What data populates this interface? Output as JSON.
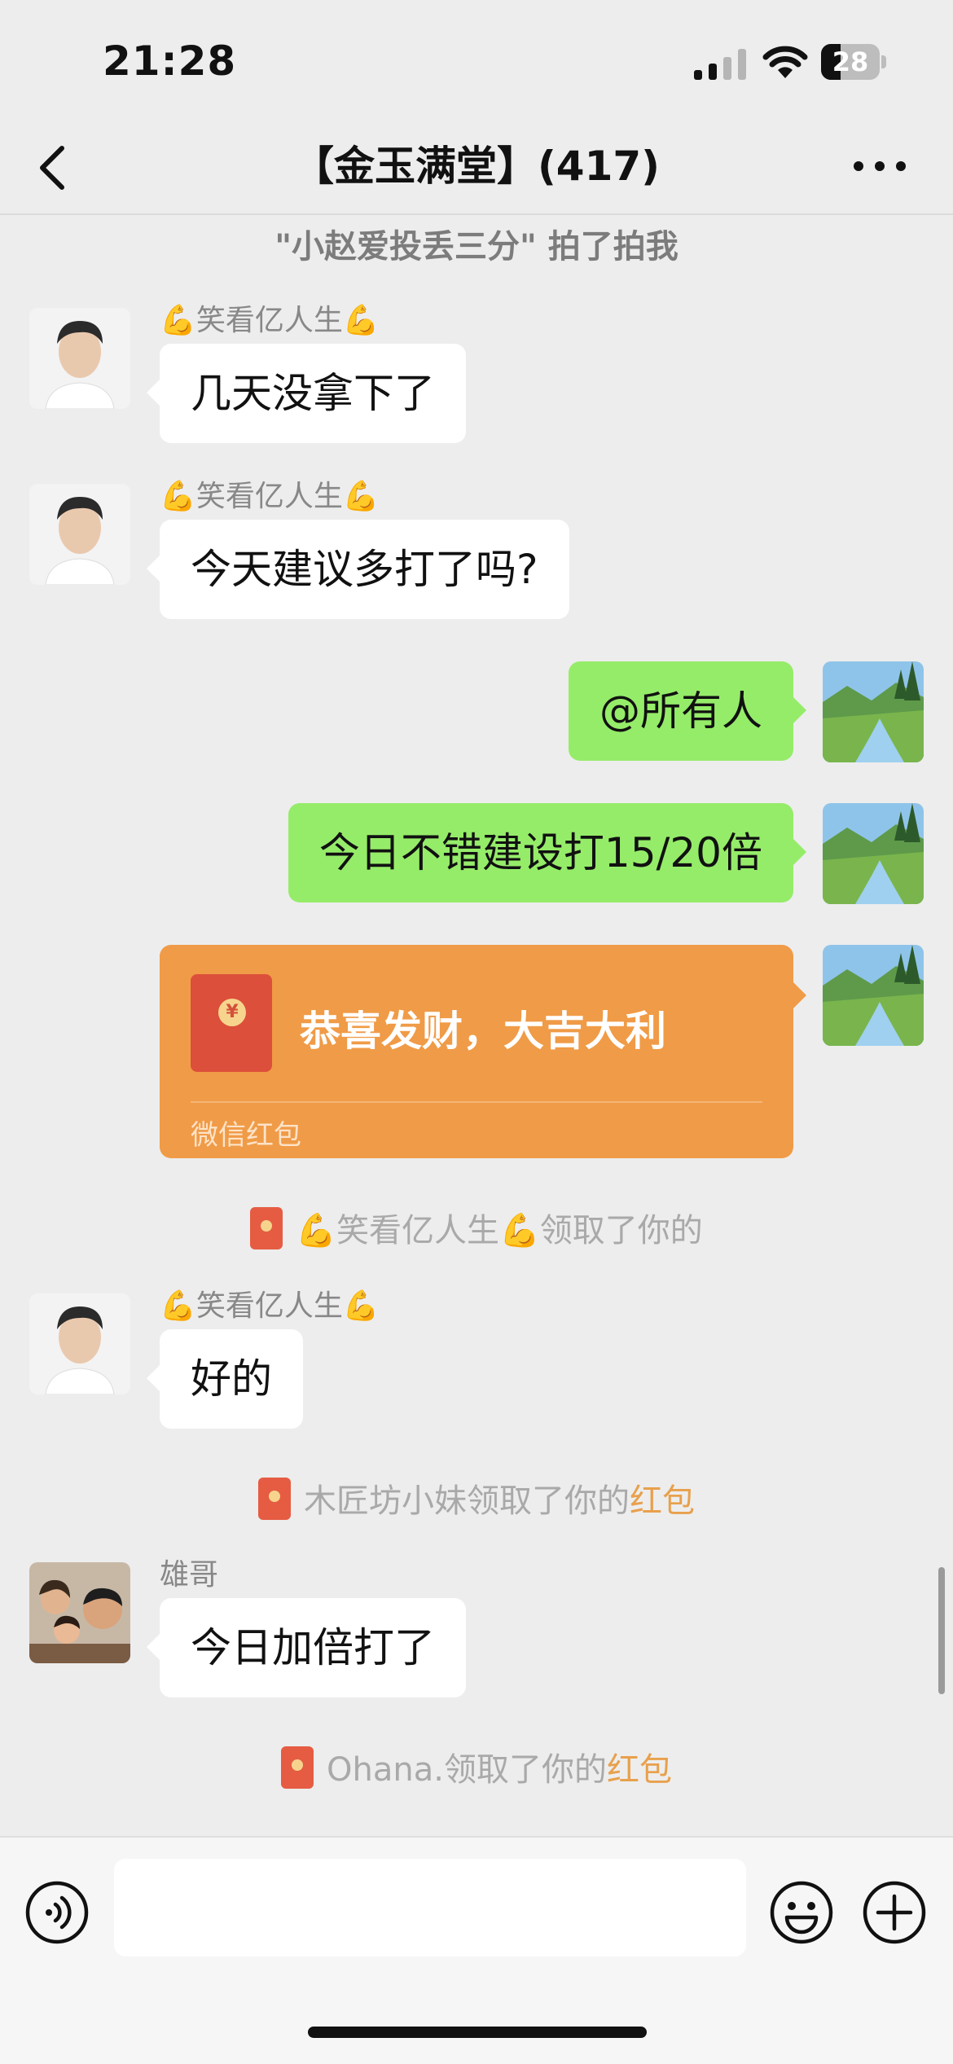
{
  "status_bar": {
    "time": "21:28",
    "battery": "28"
  },
  "nav": {
    "title": "【金玉满堂】(417)"
  },
  "messages": {
    "sys_pat": "\"小赵爱投丢三分\" 拍了拍我",
    "m1_sender": "💪笑看亿人生💪",
    "m1_text": "几天没拿下了",
    "m2_sender": "💪笑看亿人生💪",
    "m2_text": "今天建议多打了吗?",
    "m3_text": "@所有人",
    "m4_text": "今日不错建设打15/20倍",
    "redpacket_title": "恭喜发财，大吉大利",
    "redpacket_footer": "微信红包",
    "sys_claim1": "💪笑看亿人生💪领取了你的",
    "m5_sender": "💪笑看亿人生💪",
    "m5_text": "好的",
    "sys_claim2_prefix": "木匠坊小妹领取了你的",
    "sys_claim2_link": "红包",
    "m6_sender": "雄哥",
    "m6_text": "今日加倍打了",
    "sys_claim3_prefix": "Ohana.领取了你的",
    "sys_claim3_link": "红包"
  },
  "colors": {
    "accent_green": "#95ec69",
    "redpacket": "#f09b47",
    "link": "#e8a04c"
  }
}
